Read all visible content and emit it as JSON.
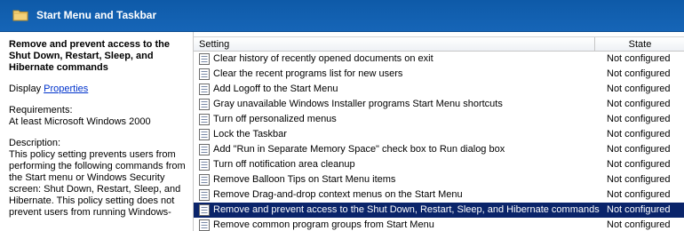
{
  "header": {
    "title": "Start Menu and Taskbar"
  },
  "details": {
    "policy_title": "Remove and prevent access to the Shut Down, Restart, Sleep, and Hibernate commands",
    "display_label": "Display",
    "display_link": "Properties",
    "requirements_label": "Requirements:",
    "requirements_value": "At least Microsoft Windows 2000",
    "description_label": "Description:",
    "description_text": "This policy setting prevents users from performing the following commands from the Start menu or Windows Security screen: Shut Down, Restart, Sleep, and Hibernate. This policy setting does not prevent users from running Windows-"
  },
  "columns": {
    "setting": "Setting",
    "state": "State"
  },
  "rows": [
    {
      "setting": "Clear history of recently opened documents on exit",
      "state": "Not configured"
    },
    {
      "setting": "Clear the recent programs list for new users",
      "state": "Not configured"
    },
    {
      "setting": "Add Logoff to the Start Menu",
      "state": "Not configured"
    },
    {
      "setting": "Gray unavailable Windows Installer programs Start Menu shortcuts",
      "state": "Not configured"
    },
    {
      "setting": "Turn off personalized menus",
      "state": "Not configured"
    },
    {
      "setting": "Lock the Taskbar",
      "state": "Not configured"
    },
    {
      "setting": "Add \"Run in Separate Memory Space\" check box to Run dialog box",
      "state": "Not configured"
    },
    {
      "setting": "Turn off notification area cleanup",
      "state": "Not configured"
    },
    {
      "setting": "Remove Balloon Tips on Start Menu items",
      "state": "Not configured"
    },
    {
      "setting": "Remove Drag-and-drop context menus on the Start Menu",
      "state": "Not configured"
    },
    {
      "setting": "Remove and prevent access to the Shut Down, Restart, Sleep, and Hibernate commands",
      "state": "Not configured"
    },
    {
      "setting": "Remove common program groups from Start Menu",
      "state": "Not configured"
    }
  ],
  "selected_row_index": 10,
  "icons": {
    "header": "folder-icon",
    "row": "policy-setting-icon"
  },
  "colors": {
    "header_bg": "#1665b7",
    "selection_bg": "#0a246a",
    "link": "#0033cc"
  }
}
